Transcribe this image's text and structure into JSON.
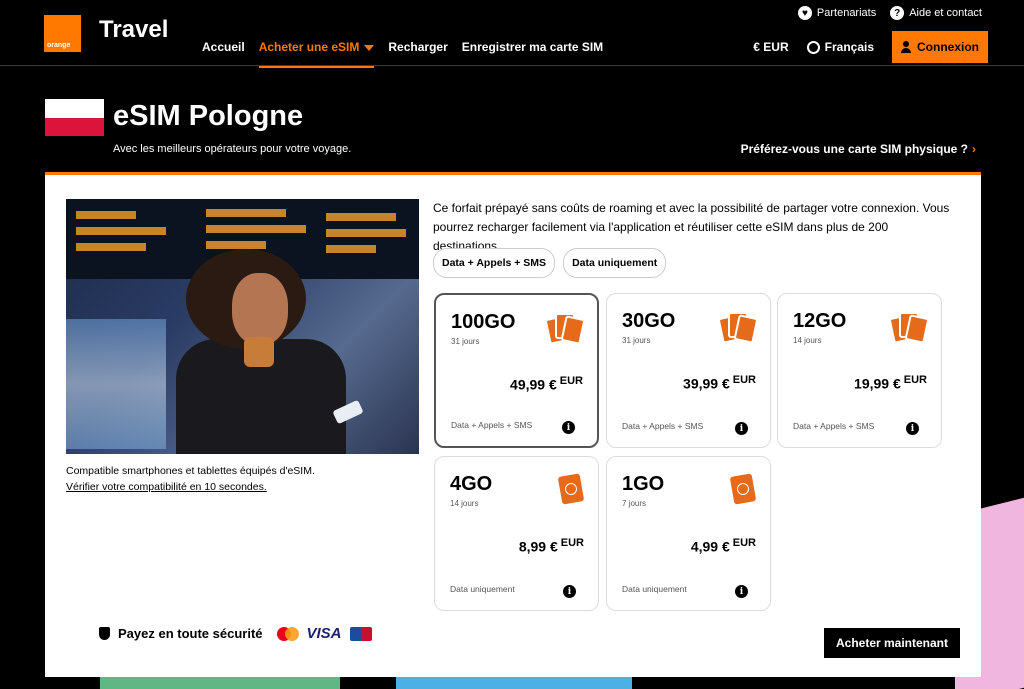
{
  "header": {
    "logo_text": "orange",
    "brand": "Travel",
    "top_links": [
      "Partenariats",
      "Aide et contact"
    ],
    "nav": [
      "Accueil",
      "Acheter une eSIM",
      "Recharger",
      "Enregistrer ma carte SIM"
    ],
    "currency": "€ EUR",
    "language": "Français",
    "login": "Connexion"
  },
  "hero": {
    "title": "eSIM Pologne",
    "subtitle": "Avec les meilleurs opérateurs pour votre voyage.",
    "physical_link": "Préférez-vous une carte SIM physique ?"
  },
  "compat": {
    "text": "Compatible smartphones et tablettes équipés d'eSIM.",
    "link": "Vérifier votre compatibilité en 10 secondes."
  },
  "description": "Ce forfait prépayé sans coûts de roaming et avec la possibilité de partager votre connexion. Vous pourrez recharger facilement via l'application et réutiliser cette eSIM dans plus de 200 destinations.",
  "filters": [
    "Data + Appels + SMS",
    "Data uniquement"
  ],
  "plans": [
    {
      "size": "100GO",
      "days": "31 jours",
      "price": "49,99 €",
      "currency": "EUR",
      "type": "Data + Appels + SMS"
    },
    {
      "size": "30GO",
      "days": "31 jours",
      "price": "39,99 €",
      "currency": "EUR",
      "type": "Data + Appels + SMS"
    },
    {
      "size": "12GO",
      "days": "14 jours",
      "price": "19,99 €",
      "currency": "EUR",
      "type": "Data + Appels + SMS"
    },
    {
      "size": "4GO",
      "days": "14 jours",
      "price": "8,99 €",
      "currency": "EUR",
      "type": "Data uniquement"
    },
    {
      "size": "1GO",
      "days": "7 jours",
      "price": "4,99 €",
      "currency": "EUR",
      "type": "Data uniquement"
    }
  ],
  "footer": {
    "secure": "Payez en toute sécurité",
    "visa": "VISA",
    "buy": "Acheter maintenant"
  },
  "colors": {
    "accent": "#ff7900",
    "flag_red": "#dc143c"
  }
}
